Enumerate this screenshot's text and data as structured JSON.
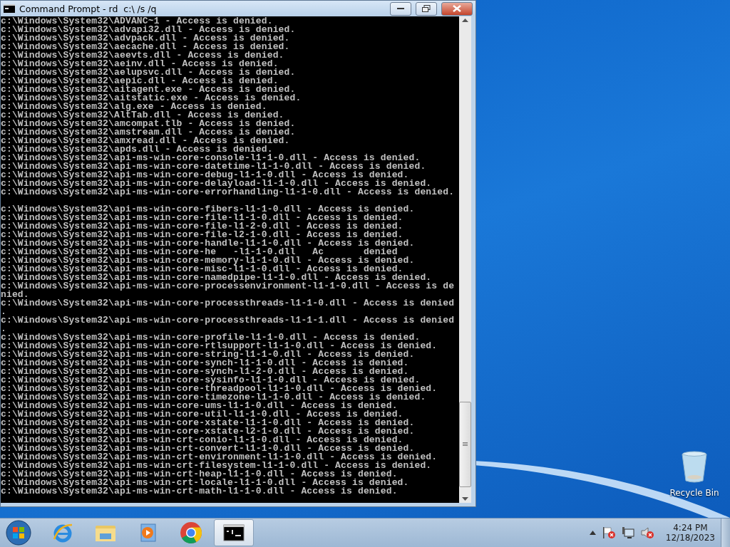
{
  "window": {
    "title": "Command Prompt - rd  c:\\ /s /q"
  },
  "console": {
    "lines": [
      "c:\\Windows\\System32\\ADVANC~1 - Access is denied.",
      "c:\\Windows\\System32\\advapi32.dll - Access is denied.",
      "c:\\Windows\\System32\\advpack.dll - Access is denied.",
      "c:\\Windows\\System32\\aecache.dll - Access is denied.",
      "c:\\Windows\\System32\\aeevts.dll - Access is denied.",
      "c:\\Windows\\System32\\aeinv.dll - Access is denied.",
      "c:\\Windows\\System32\\aelupsvc.dll - Access is denied.",
      "c:\\Windows\\System32\\aepic.dll - Access is denied.",
      "c:\\Windows\\System32\\aitagent.exe - Access is denied.",
      "c:\\Windows\\System32\\aitstatic.exe - Access is denied.",
      "c:\\Windows\\System32\\alg.exe - Access is denied.",
      "c:\\Windows\\System32\\AltTab.dll - Access is denied.",
      "c:\\Windows\\System32\\amcompat.tlb - Access is denied.",
      "c:\\Windows\\System32\\amstream.dll - Access is denied.",
      "c:\\Windows\\System32\\amxread.dll - Access is denied.",
      "c:\\Windows\\System32\\apds.dll - Access is denied.",
      "c:\\Windows\\System32\\api-ms-win-core-console-l1-1-0.dll - Access is denied.",
      "c:\\Windows\\System32\\api-ms-win-core-datetime-l1-1-0.dll - Access is denied.",
      "c:\\Windows\\System32\\api-ms-win-core-debug-l1-1-0.dll - Access is denied.",
      "c:\\Windows\\System32\\api-ms-win-core-delayload-l1-1-0.dll - Access is denied.",
      "c:\\Windows\\System32\\api-ms-win-core-errorhandling-l1-1-0.dll - Access is denied.",
      "c:\\Windows\\System32\\api-ms-win-core-fibers-l1-1-0.dll - Access is denied.",
      "c:\\Windows\\System32\\api-ms-win-core-file-l1-1-0.dll - Access is denied.",
      "c:\\Windows\\System32\\api-ms-win-core-file-l1-2-0.dll - Access is denied.",
      "c:\\Windows\\System32\\api-ms-win-core-file-l2-1-0.dll - Access is denied.",
      "c:\\Windows\\System32\\api-ms-win-core-handle-l1-1-0.dll - Access is denied.",
      "c:\\Windows\\System32\\api-ms-win-core-he   -l1-1-0.dll   Ac       denied",
      "c:\\Windows\\System32\\api-ms-win-core-memory-l1-1-0.dll - Access is denied.",
      "c:\\Windows\\System32\\api-ms-win-core-misc-l1-1-0.dll - Access is denied.",
      "c:\\Windows\\System32\\api-ms-win-core-namedpipe-l1-1-0.dll - Access is denied.",
      "c:\\Windows\\System32\\api-ms-win-core-processenvironment-l1-1-0.dll - Access is denied.",
      "c:\\Windows\\System32\\api-ms-win-core-processthreads-l1-1-0.dll - Access is denied.",
      "c:\\Windows\\System32\\api-ms-win-core-processthreads-l1-1-1.dll - Access is denied.",
      "c:\\Windows\\System32\\api-ms-win-core-profile-l1-1-0.dll - Access is denied.",
      "c:\\Windows\\System32\\api-ms-win-core-rtlsupport-l1-1-0.dll - Access is denied.",
      "c:\\Windows\\System32\\api-ms-win-core-string-l1-1-0.dll - Access is denied.",
      "c:\\Windows\\System32\\api-ms-win-core-synch-l1-1-0.dll - Access is denied.",
      "c:\\Windows\\System32\\api-ms-win-core-synch-l1-2-0.dll - Access is denied.",
      "c:\\Windows\\System32\\api-ms-win-core-sysinfo-l1-1-0.dll - Access is denied.",
      "c:\\Windows\\System32\\api-ms-win-core-threadpool-l1-1-0.dll - Access is denied.",
      "c:\\Windows\\System32\\api-ms-win-core-timezone-l1-1-0.dll - Access is denied.",
      "c:\\Windows\\System32\\api-ms-win-core-ums-l1-1-0.dll - Access is denied.",
      "c:\\Windows\\System32\\api-ms-win-core-util-l1-1-0.dll - Access is denied.",
      "c:\\Windows\\System32\\api-ms-win-core-xstate-l1-1-0.dll - Access is denied.",
      "c:\\Windows\\System32\\api-ms-win-core-xstate-l2-1-0.dll - Access is denied.",
      "c:\\Windows\\System32\\api-ms-win-crt-conio-l1-1-0.dll - Access is denied.",
      "c:\\Windows\\System32\\api-ms-win-crt-convert-l1-1-0.dll - Access is denied.",
      "c:\\Windows\\System32\\api-ms-win-crt-environment-l1-1-0.dll - Access is denied.",
      "c:\\Windows\\System32\\api-ms-win-crt-filesystem-l1-1-0.dll - Access is denied.",
      "c:\\Windows\\System32\\api-ms-win-crt-heap-l1-1-0.dll - Access is denied.",
      "c:\\Windows\\System32\\api-ms-win-crt-locale-l1-1-0.dll - Access is denied.",
      "c:\\Windows\\System32\\api-ms-win-crt-math-l1-1-0.dll - Access is denied."
    ]
  },
  "desktop_icons": [
    {
      "label": "Recycle Bin"
    }
  ],
  "taskbar": {
    "items": [
      {
        "kind": "ie",
        "selected": false
      },
      {
        "kind": "explorer",
        "selected": false
      },
      {
        "kind": "media",
        "selected": false
      },
      {
        "kind": "chrome",
        "selected": false
      },
      {
        "kind": "cmd",
        "selected": true
      }
    ]
  },
  "tray": {
    "time": "4:24 PM",
    "date": "12/18/2023"
  }
}
